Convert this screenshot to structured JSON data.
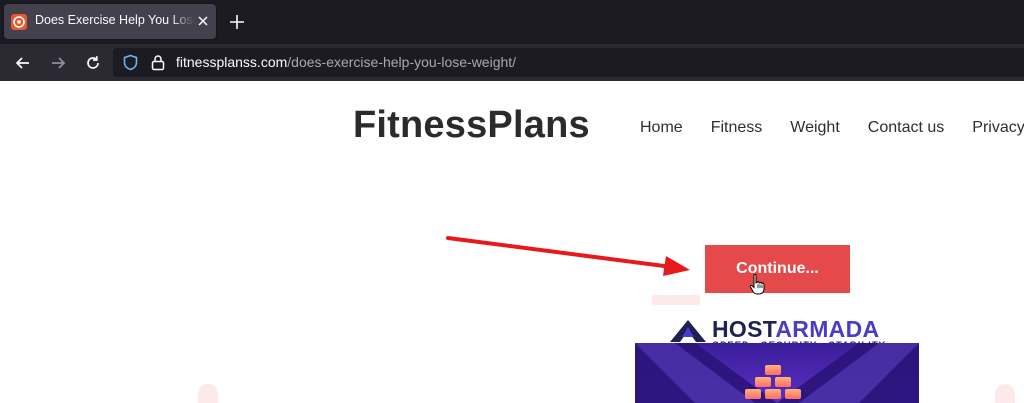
{
  "browser": {
    "tab": {
      "title": "Does Exercise Help You Lose Weight",
      "favicon": "fitness-favicon-icon",
      "close_icon": "close-icon"
    },
    "new_tab_icon": "plus-icon",
    "nav": {
      "back_icon": "back-arrow-icon",
      "forward_icon": "forward-arrow-icon",
      "reload_icon": "reload-icon"
    },
    "address": {
      "shield_icon": "tracking-protection-shield-icon",
      "lock_icon": "lock-icon",
      "host": "fitnessplanss.com",
      "path": "/does-exercise-help-you-lose-weight/"
    }
  },
  "site": {
    "title": "FitnessPlans",
    "menu": [
      "Home",
      "Fitness",
      "Weight",
      "Contact us",
      "Privacy"
    ]
  },
  "main": {
    "continue_label": "Continue...",
    "annotation": "red-arrow-pointing-to-continue-button",
    "cursor": "hand-pointer-cursor"
  },
  "ad": {
    "brand_part1": "HOST",
    "brand_part2": "ARMADA",
    "tagline": "SPEED · SECURITY · STABILITY",
    "logo": "hostarmada-logo-icon"
  },
  "colors": {
    "tabbar_bg": "#1c1b22",
    "navbar_bg": "#2b2a33",
    "button_bg": "#e64949",
    "arrow": "#e8191c",
    "brand_dark": "#1e2252",
    "brand_accent": "#4a3cc8"
  }
}
